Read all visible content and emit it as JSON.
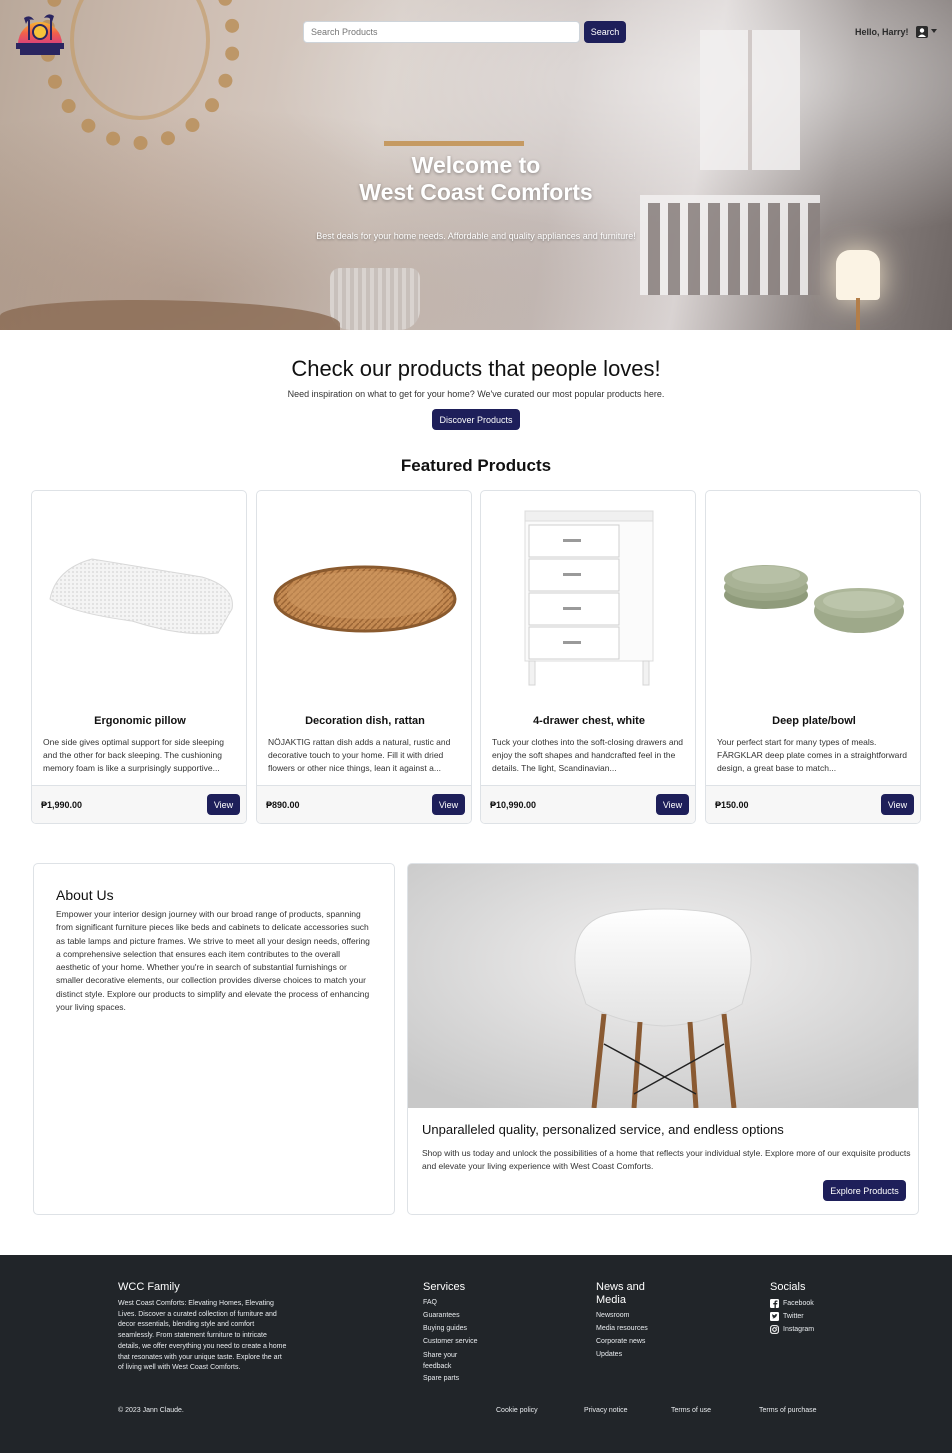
{
  "header": {
    "logo_alt": "WEST COAST COMFORTS",
    "search_placeholder": "Search Products",
    "search_button": "Search",
    "greeting": "Hello, Harry!",
    "user_icon": "user-icon"
  },
  "hero": {
    "title_line1": "Welcome to",
    "title_line2": "West Coast Comforts",
    "subtitle": "Best deals for your home needs. Affordable and quality appliances and furniture!"
  },
  "loves": {
    "title": "Check our products that people loves!",
    "subtitle": "Need inspiration on what to get for your home? We've curated our most popular products here.",
    "button": "Discover Products"
  },
  "featured": {
    "title": "Featured Products",
    "products": [
      {
        "name": "Ergonomic pillow",
        "description": "One side gives optimal support for side sleeping and the other for back sleeping. The cushioning memory foam is like a surprisingly supportive...",
        "price": "₱1,990.00",
        "button": "View"
      },
      {
        "name": "Decoration dish, rattan",
        "description": "NÖJAKTIG rattan dish adds a natural, rustic and decorative touch to your home. Fill it with dried flowers or other nice things, lean it against a...",
        "price": "₱890.00",
        "button": "View"
      },
      {
        "name": "4-drawer chest, white",
        "description": "Tuck your clothes into the soft-closing drawers and enjoy the soft shapes and handcrafted feel in the details. The light, Scandinavian...",
        "price": "₱10,990.00",
        "button": "View"
      },
      {
        "name": "Deep plate/bowl",
        "description": "Your perfect start for many types of meals. FÄRGKLAR deep plate comes in a straightforward design, a great base to match...",
        "price": "₱150.00",
        "button": "View"
      }
    ]
  },
  "about": {
    "title": "About Us",
    "text": "Empower your interior design journey with our broad range of products, spanning from significant furniture pieces like beds and cabinets to delicate accessories such as table lamps and picture frames. We strive to meet all your design needs, offering a comprehensive selection that ensures each item contributes to the overall aesthetic of your home. Whether you're in search of substantial furnishings or smaller decorative elements, our collection provides diverse choices to match your distinct style. Explore our products to simplify and elevate the process of enhancing your living spaces."
  },
  "promo": {
    "title": "Unparalleled quality, personalized service, and endless options",
    "text": "Shop with us today and unlock the possibilities of a home that reflects your individual style. Explore more of our exquisite products and elevate your living experience with West Coast Comforts.",
    "button": "Explore Products"
  },
  "footer": {
    "family_title": "WCC Family",
    "family_text": "West Coast Comforts: Elevating Homes, Elevating Lives. Discover a curated collection of furniture and decor essentials, blending style and comfort seamlessly. From statement furniture to intricate details, we offer everything you need to create a home that resonates with your unique taste. Explore the art of living well with West Coast Comforts.",
    "services_title": "Services",
    "services": [
      "FAQ",
      "Guarantees",
      "Buying guides",
      "Customer service",
      "Share your feedback",
      "Spare parts"
    ],
    "news_title": "News and Media",
    "news": [
      "Newsroom",
      "Media resources",
      "Corporate news",
      "Updates"
    ],
    "socials_title": "Socials",
    "socials": [
      "Facebook",
      "Twitter",
      "Instagram"
    ],
    "copyright": "© 2023 Jann Claude.",
    "legal": [
      "Cookie policy",
      "Privacy notice",
      "Terms of use",
      "Terms of purchase"
    ]
  },
  "colors": {
    "brand_navy": "#1e1f5a",
    "footer_bg": "#212529"
  }
}
